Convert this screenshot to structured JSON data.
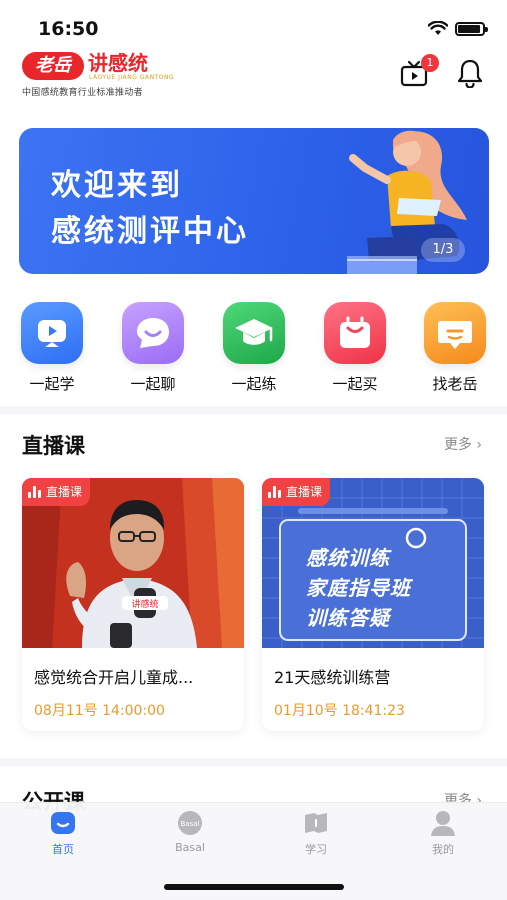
{
  "status_bar": {
    "time": "16:50"
  },
  "header": {
    "logo_badge": "老岳",
    "logo_text": "讲感统",
    "logo_pinyin": "LAOYUE JIANG GANTONG",
    "slogan": "中国感统教育行业标准推动者",
    "tv_badge_count": "1"
  },
  "banner": {
    "line1": "欢迎来到",
    "line2": "感统测评中心",
    "indicator": "1/3"
  },
  "quick_entries": [
    {
      "label": "一起学",
      "icon": "play-icon",
      "color": "#3a78f5"
    },
    {
      "label": "一起聊",
      "icon": "chat-icon",
      "color": "#a87ef7"
    },
    {
      "label": "一起练",
      "icon": "graduation-cap-icon",
      "color": "#2dbb5c"
    },
    {
      "label": "一起买",
      "icon": "shopping-bag-icon",
      "color": "#f5445a"
    },
    {
      "label": "找老岳",
      "icon": "message-icon",
      "color": "#f79a2a"
    }
  ],
  "live_section": {
    "title": "直播课",
    "more": "更多",
    "cards": [
      {
        "tag": "直播课",
        "title": "感觉统合开启儿童成...",
        "time": "08月11号 14:00:00",
        "image_caption": "讲感统"
      },
      {
        "tag": "直播课",
        "title": "21天感统训练营",
        "time": "01月10号 18:41:23",
        "image_lines": [
          "感统训练",
          "家庭指导班",
          "训练答疑"
        ]
      }
    ]
  },
  "public_section": {
    "title": "公开课",
    "more": "更多"
  },
  "tab_bar": {
    "items": [
      {
        "label": "首页",
        "icon": "home-icon",
        "active": true
      },
      {
        "label": "Basal",
        "icon": "basal-icon",
        "badge_text": "Basal",
        "active": false
      },
      {
        "label": "学习",
        "icon": "book-icon",
        "active": false
      },
      {
        "label": "我的",
        "icon": "profile-icon",
        "active": false
      }
    ]
  },
  "colors": {
    "brand_red": "#e8262c",
    "banner_blue": "#2d63ea",
    "active_tab": "#3575f0",
    "time_orange": "#eb9a2d"
  }
}
